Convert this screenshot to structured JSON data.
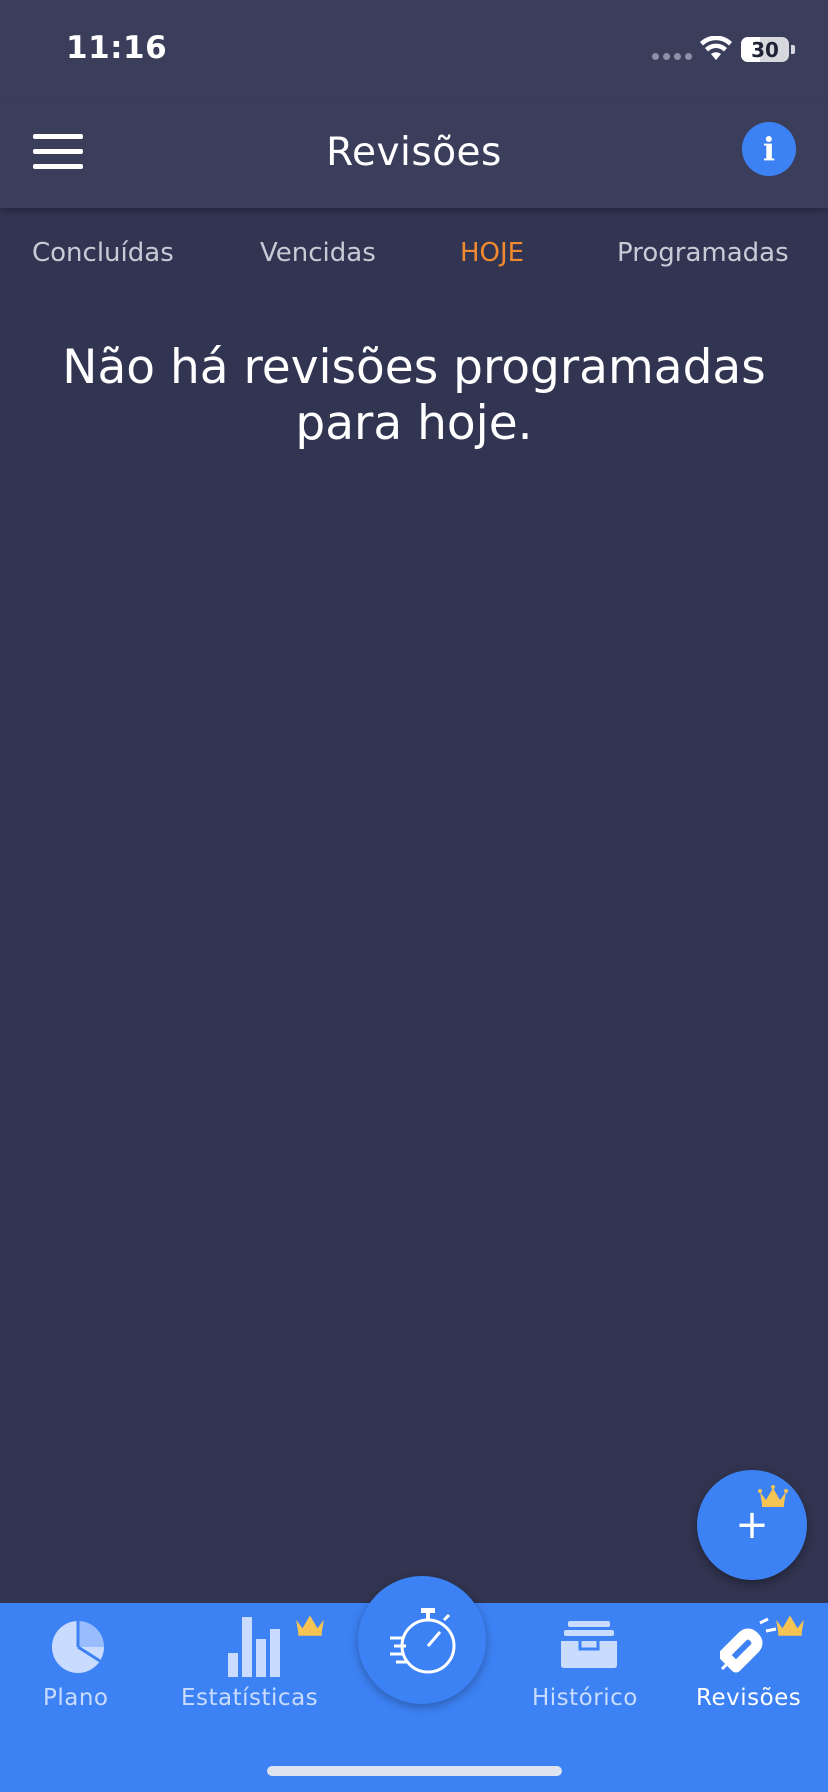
{
  "status_bar": {
    "time": "11:16",
    "battery": "30"
  },
  "header": {
    "title": "Revisões",
    "info_label": "i"
  },
  "tabs": [
    {
      "label": "Concluídas",
      "active": false
    },
    {
      "label": "Vencidas",
      "active": false
    },
    {
      "label": "HOJE",
      "active": true
    },
    {
      "label": "Programadas",
      "active": false
    }
  ],
  "main": {
    "empty_message": "Não há revisões programadas para hoje."
  },
  "fab": {
    "label": "+"
  },
  "bottom_nav": {
    "items": [
      {
        "label": "Plano",
        "icon": "pie-chart-icon"
      },
      {
        "label": "Estatísticas",
        "icon": "bar-chart-icon"
      },
      {
        "label": "Histórico",
        "icon": "archive-icon"
      },
      {
        "label": "Revisões",
        "icon": "magnet-icon",
        "active": true
      }
    ],
    "center_icon": "stopwatch-icon"
  },
  "colors": {
    "background": "#313551",
    "header": "#3a3e5b",
    "accent": "#3d82f5",
    "active_tab": "#f0892f",
    "crown": "#f6c453"
  }
}
